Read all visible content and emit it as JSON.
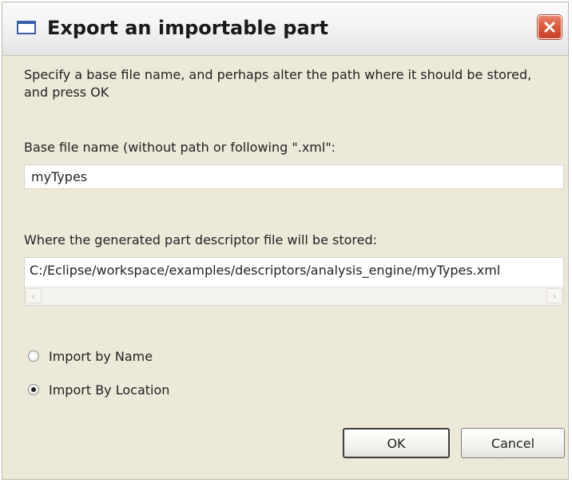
{
  "dialog": {
    "title": "Export an importable part",
    "icons": {
      "window": "window-icon",
      "close": "close-icon"
    },
    "colors": {
      "close_button": "#d9583c",
      "window_icon_border": "#3a5fa8"
    }
  },
  "instructions": {
    "line1": "Specify a base file name, and perhaps alter the path where it should be stored,",
    "line2": "and press OK"
  },
  "base_name": {
    "label": "Base file name (without path or following \".xml\":",
    "value": "myTypes"
  },
  "path": {
    "label": "Where the generated part descriptor file will be stored:",
    "value": "C:/Eclipse/workspace/examples/descriptors/analysis_engine/myTypes.xml"
  },
  "import_options": [
    {
      "label": "Import by Name",
      "checked": false
    },
    {
      "label": "Import By Location",
      "checked": true
    }
  ],
  "buttons": {
    "ok": "OK",
    "cancel": "Cancel"
  }
}
